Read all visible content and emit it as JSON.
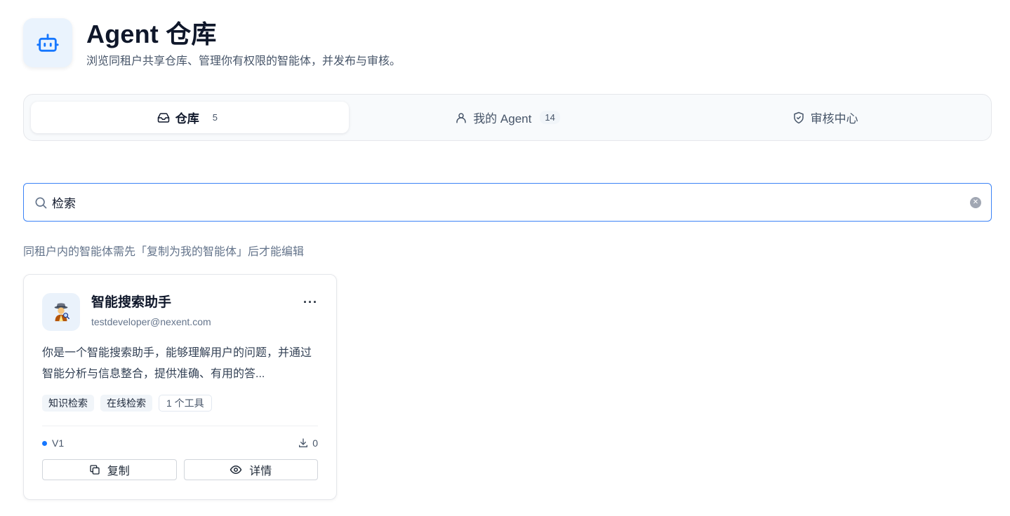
{
  "header": {
    "title": "Agent 仓库",
    "subtitle": "浏览同租户共享仓库、管理你有权限的智能体，并发布与审核。",
    "icon": "robot-icon"
  },
  "tabs": [
    {
      "label": "仓库",
      "count": "5",
      "icon": "inbox-icon",
      "active": true
    },
    {
      "label": "我的 Agent",
      "count": "14",
      "icon": "user-icon",
      "active": false
    },
    {
      "label": "审核中心",
      "count": "",
      "icon": "shield-check-icon",
      "active": false
    }
  ],
  "search": {
    "value": "检索",
    "placeholder": ""
  },
  "hint": "同租户内的智能体需先「复制为我的智能体」后才能编辑",
  "cards": [
    {
      "name": "智能搜索助手",
      "author": "testdeveloper@nexent.com",
      "avatar": "detective-emoji",
      "description": "你是一个智能搜索助手，能够理解用户的问题，并通过智能分析与信息整合，提供准确、有用的答...",
      "tags": [
        "知识检索",
        "在线检索"
      ],
      "tools": "1 个工具",
      "version": "V1",
      "downloads": "0",
      "copy_label": "复制",
      "detail_label": "详情",
      "more": "···"
    }
  ],
  "colors": {
    "accent": "#1677ff",
    "search_border": "#3b82f6",
    "icon_bg": "#eaf3fd"
  }
}
